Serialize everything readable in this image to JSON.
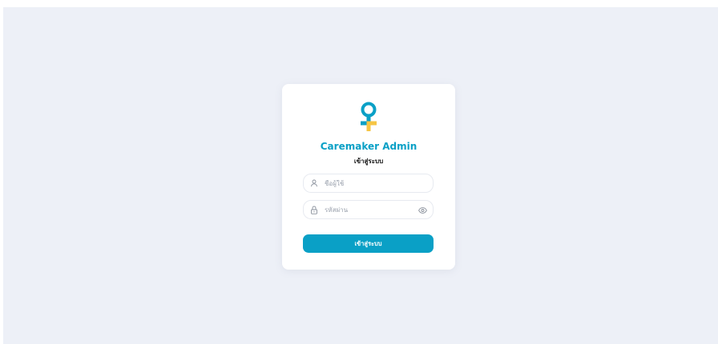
{
  "app": {
    "brand_name": "Caremaker Admin",
    "subtitle": "เข้าสู่ระบบ"
  },
  "logo": {
    "icon": "female-symbol-logo",
    "ring_color": "#0aa0c6",
    "cross_color": "#f6c544"
  },
  "form": {
    "username": {
      "icon": "user-icon",
      "placeholder": "ชื่อผู้ใช้",
      "value": ""
    },
    "password": {
      "icon": "lock-icon",
      "placeholder": "รหัสผ่าน",
      "value": "",
      "toggle_icon": "eye-icon"
    },
    "submit_label": "เข้าสู่ระบบ"
  },
  "colors": {
    "background": "#edf0f7",
    "card": "#ffffff",
    "accent": "#0aa0c6"
  }
}
